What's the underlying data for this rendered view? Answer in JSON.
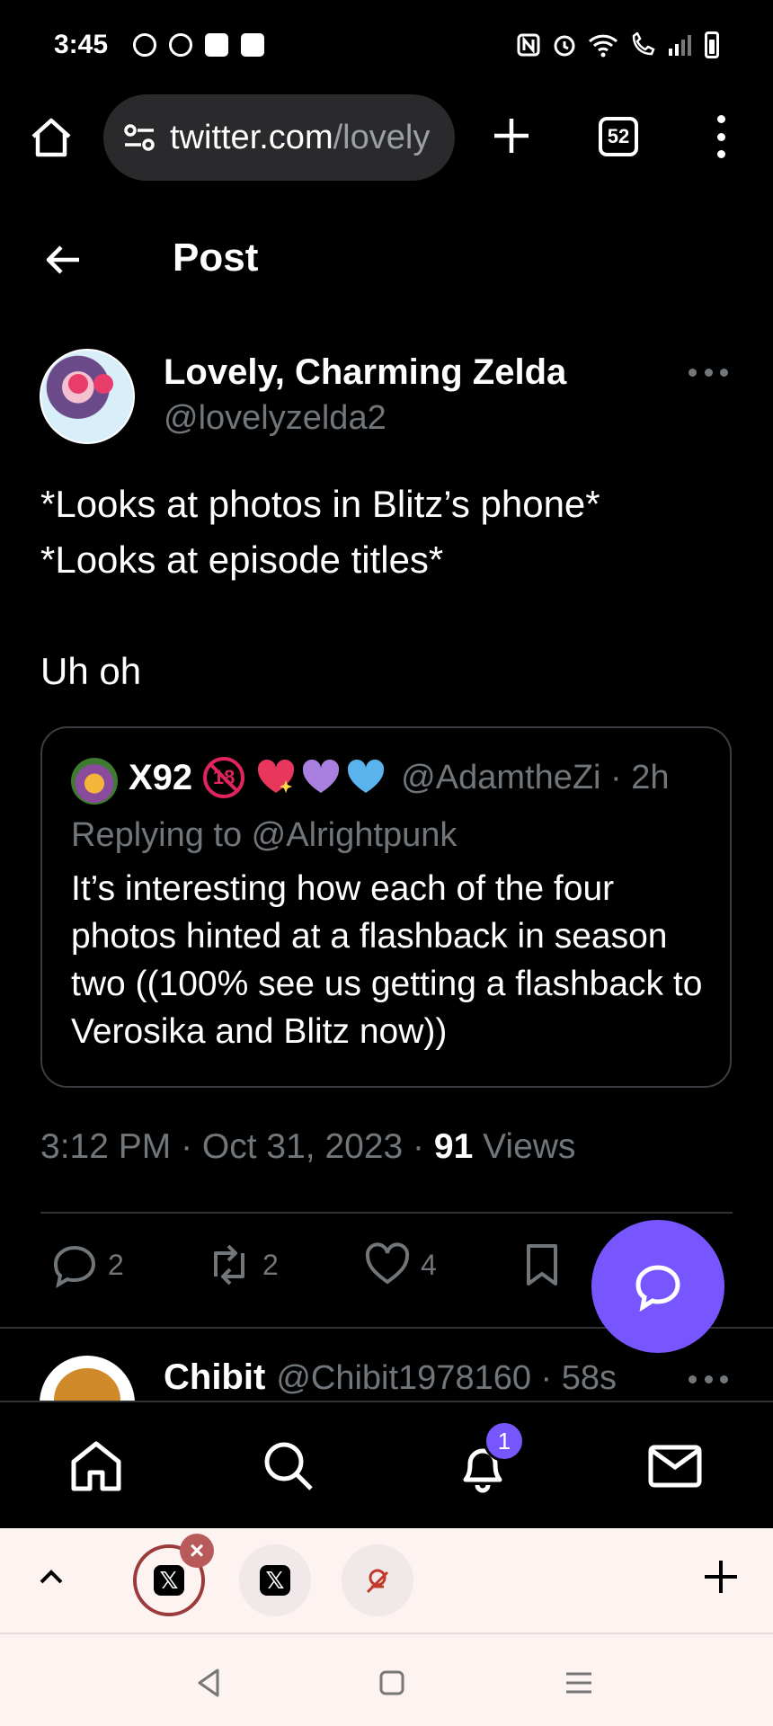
{
  "status_bar": {
    "time": "3:45"
  },
  "browser": {
    "url_host": "twitter.com",
    "url_path": "/lovely",
    "tab_count": "52"
  },
  "header": {
    "title": "Post"
  },
  "post": {
    "author_name": "Lovely, Charming Zelda",
    "author_handle": "@lovelyzelda2",
    "text_lines": [
      "*Looks at photos in Blitz’s phone*",
      "*Looks at episode titles*",
      "",
      "Uh oh"
    ],
    "quote": {
      "name": "X92",
      "badge_18": "18",
      "handle_time": "@AdamtheZi · 2h",
      "replying_to": "Replying to @Alrightpunk",
      "text": "It’s interesting how each of the four photos hinted at a flashback in season two ((100% see us getting a flashback to Verosika and Blitz now))"
    },
    "timestamp": "3:12 PM · Oct 31, 2023 · ",
    "views_count": "91",
    "views_label": " Views",
    "actions": {
      "replies": "2",
      "reposts": "2",
      "likes": "4"
    }
  },
  "next_post": {
    "name": "Chibit",
    "handle_time": "@Chibit1978160 · 58s"
  },
  "bottom_nav": {
    "notification_count": "1"
  },
  "colors": {
    "accent": "#7856ff",
    "muted": "#71767b",
    "background": "#000000"
  }
}
